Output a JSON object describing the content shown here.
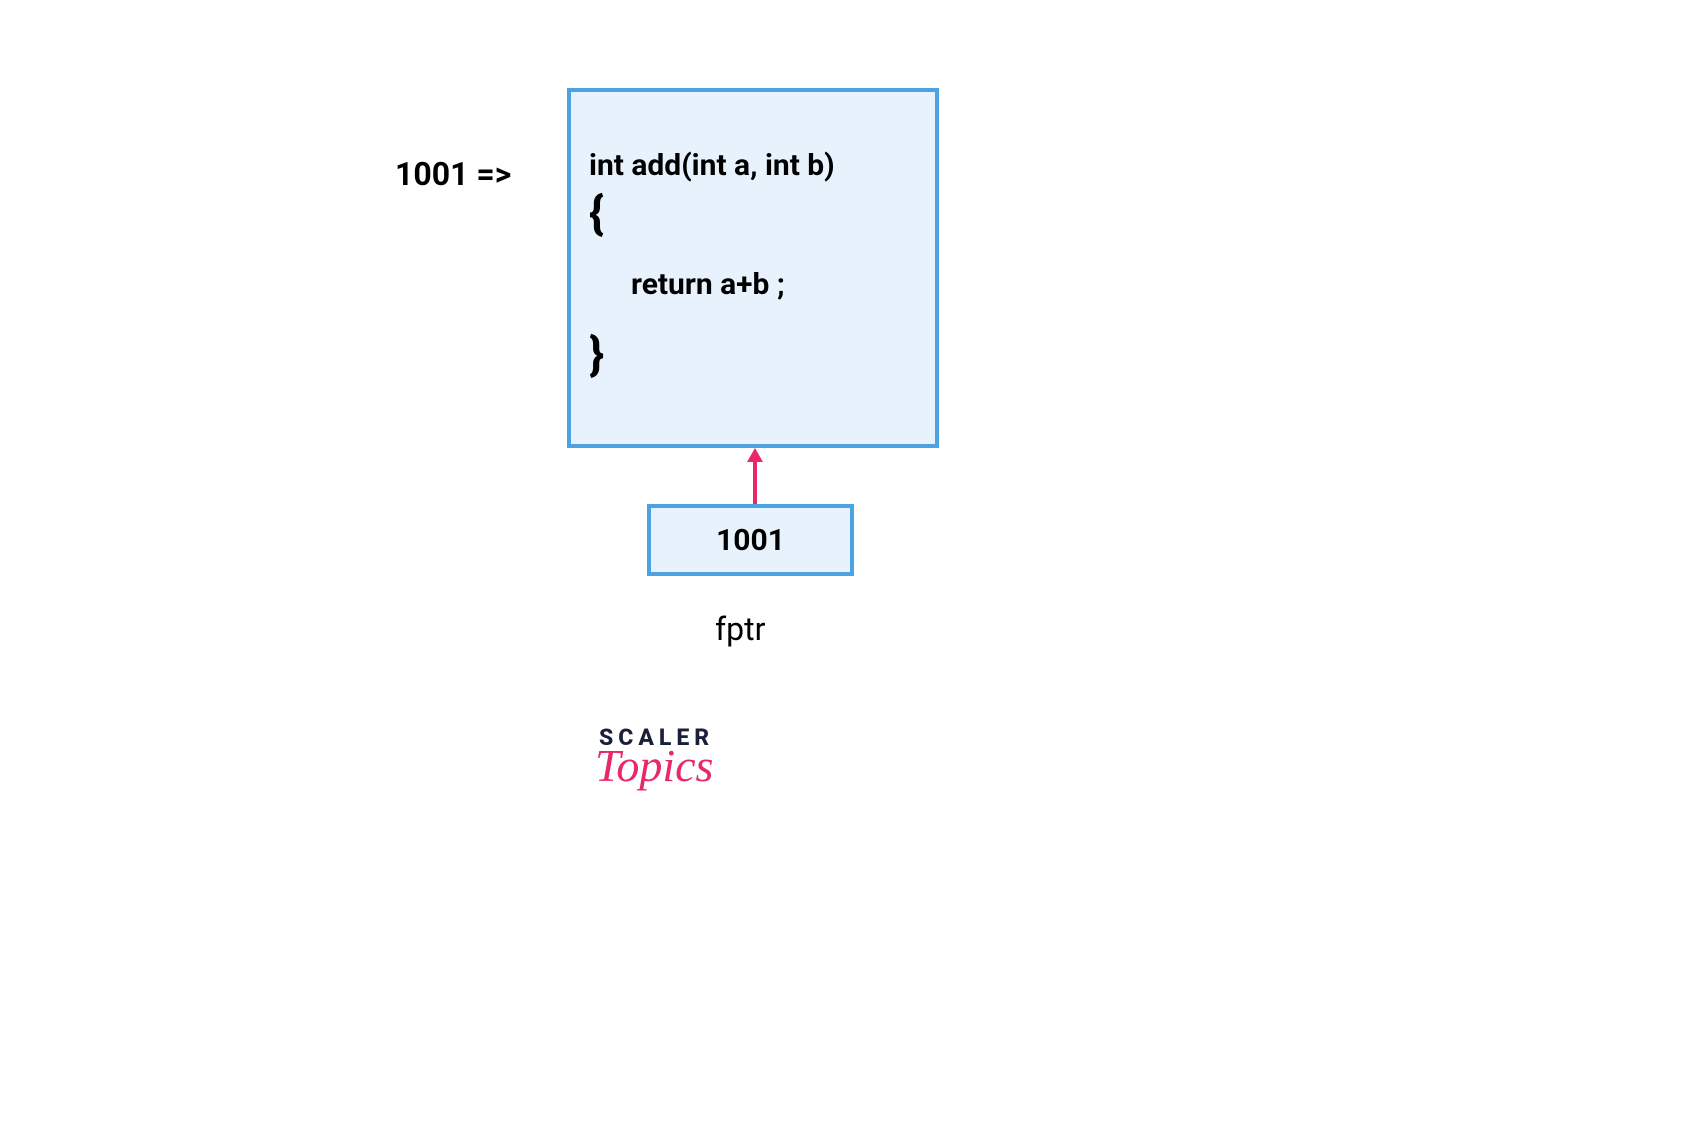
{
  "diagram": {
    "address_label": "1001  =>",
    "code": {
      "signature": "int add(int a, int b)",
      "open_brace": "{",
      "body": "return a+b ;",
      "close_brace": "}"
    },
    "pointer_box": {
      "value": "1001",
      "name": "fptr"
    },
    "arrow": {
      "color": "#e8286b",
      "from": "pointer_box",
      "to": "code_box"
    }
  },
  "logo": {
    "top": "SCALER",
    "bottom": "Topics"
  },
  "colors": {
    "box_fill": "#e8f2fc",
    "box_border": "#4ba3e3",
    "arrow": "#e8286b",
    "logo_dark": "#1a1f3a",
    "logo_pink": "#e8286b"
  }
}
